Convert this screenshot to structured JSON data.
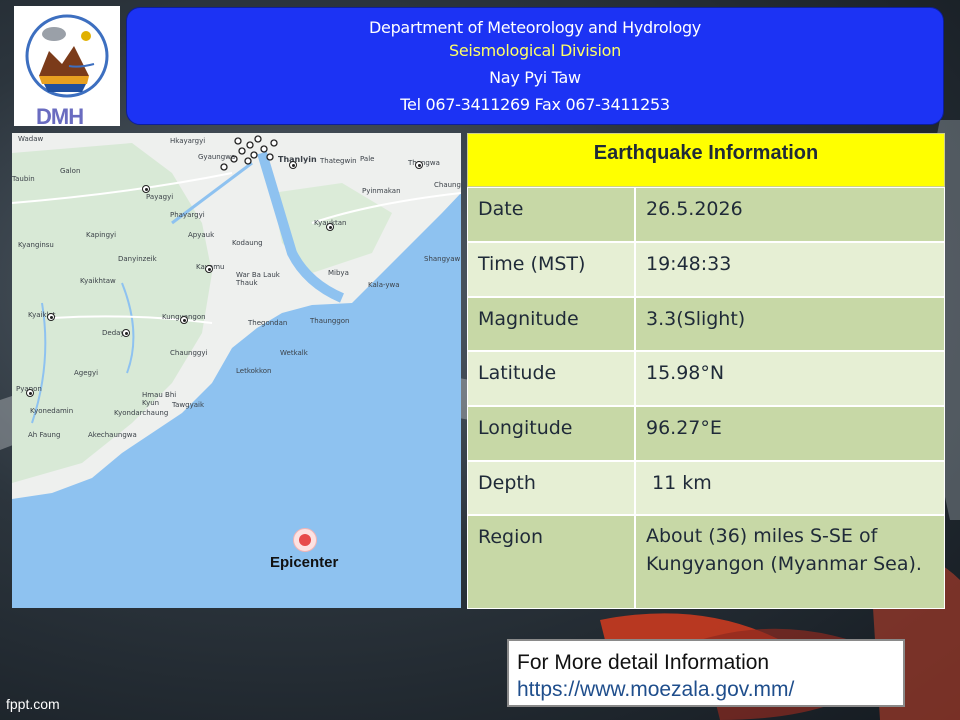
{
  "header": {
    "department": "Department of Meteorology and Hydrology",
    "division": "Seismological Division",
    "city": "Nay Pyi Taw",
    "contact": "Tel 067-3411269 Fax 067-3411253",
    "logo_text": "DMH"
  },
  "map": {
    "places": [
      "Wadaw",
      "Hkayargyi",
      "Gyaungwa",
      "Thanlyin",
      "Thategwin",
      "Pale",
      "Thongwa",
      "Taubin",
      "Galon",
      "Payagyi",
      "Pyinmakan",
      "Chaungwa",
      "Phayargyi",
      "Kyauktan",
      "Kapingyi",
      "Apyauk",
      "Kyanginsu",
      "Kodaung",
      "Shangyaw",
      "Danyinzeik",
      "Kayamu",
      "Mibya",
      "Kyaikhtaw",
      "War Ba Lauk Thauk",
      "Kala-ywa",
      "Kungyangon",
      "Thegondan",
      "Thaunggon",
      "Kyaiklat",
      "Dedaye",
      "Wetkalk",
      "Chaunggyi",
      "Agegyi",
      "Letkokkon",
      "Pyapon",
      "Hmau Bhi Kyun",
      "Tawgyaik",
      "Kyonedamin",
      "Kyondarchaung",
      "Ah Faung",
      "Akechaungwa"
    ],
    "epicenter_label": "Epicenter"
  },
  "info": {
    "title": "Earthquake Information",
    "rows": [
      {
        "label": "Date",
        "value": "26.5.2026"
      },
      {
        "label": "Time (MST)",
        "value": "19:48:33"
      },
      {
        "label": "Magnitude",
        "value": "3.3(Slight)"
      },
      {
        "label": "Latitude",
        "value": "15.98°N"
      },
      {
        "label": "Longitude",
        "value": "96.27°E"
      },
      {
        "label": "Depth",
        "value": " 11 km"
      },
      {
        "label": "Region",
        "value": "About (36)  miles S-SE of Kungyangon (Myanmar Sea)."
      }
    ]
  },
  "footer": {
    "more_label": "For More detail Information",
    "more_url": "https://www.moezala.gov.mm/",
    "credit": "fppt.com"
  }
}
